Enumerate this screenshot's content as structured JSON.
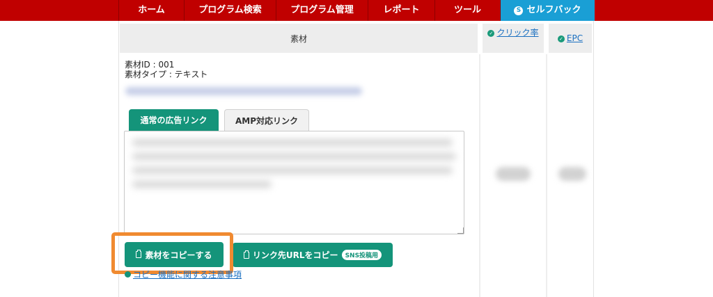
{
  "nav": {
    "items": [
      "ホーム",
      "プログラム検索",
      "プログラム管理",
      "レポート",
      "ツール"
    ],
    "selfback": {
      "label": "セルフバック",
      "icon": "selfback-icon"
    }
  },
  "table": {
    "material_header": "素材",
    "click_rate_header": "クリック率",
    "epc_header": "EPC"
  },
  "material": {
    "id_line": "素材ID : 001",
    "type_line": "素材タイプ : テキスト",
    "tabs": {
      "normal": "通常の広告リンク",
      "amp": "AMP対応リンク"
    },
    "copy_button": "素材をコピーする",
    "copy_url_button": "リンク先URLをコピー",
    "sns_badge": "SNS投稿用",
    "note_link": "コピー機能に関する注意事項"
  },
  "colors": {
    "nav_red": "#c00000",
    "selfback_blue": "#1a9fd5",
    "accent_green": "#14947a",
    "highlight_orange": "#f08a30",
    "link_blue": "#1a6fc0"
  }
}
